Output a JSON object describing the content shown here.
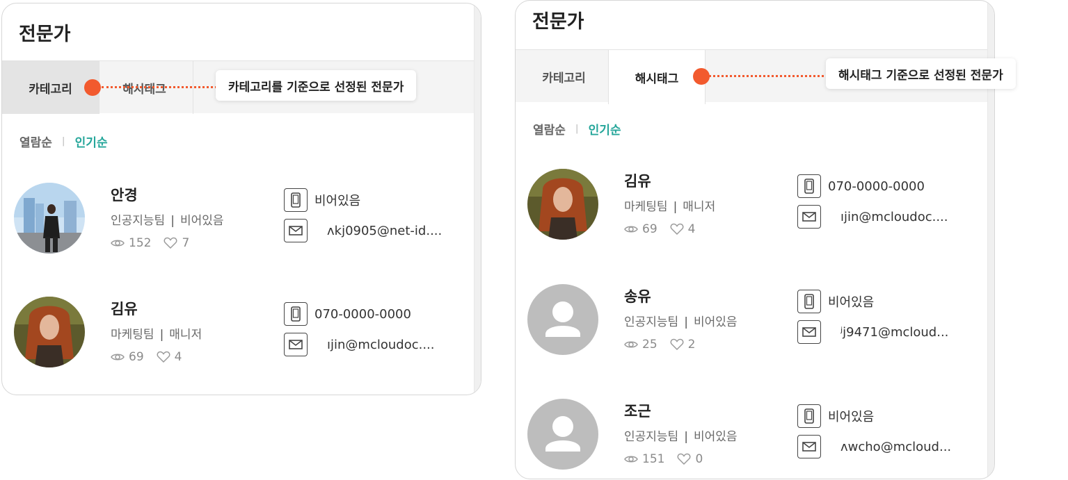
{
  "colors": {
    "accent": "#25a69a",
    "callout_dot": "#f25a2e"
  },
  "left": {
    "title": "전문가",
    "tabs": [
      "카테고리",
      "해시태그"
    ],
    "sort": [
      "열람순",
      "인기순"
    ],
    "callout": "카테고리를 기준으로 선정된 전문가",
    "experts": [
      {
        "name": "안경",
        "team": "인공지능팀",
        "role": "비어있음",
        "views": "152",
        "likes": "7",
        "phone": "비어있음",
        "email": "ʌkj0905@net-id....",
        "avatar": "photo-man"
      },
      {
        "name": "김유",
        "team": "마케팅팀",
        "role": "매니저",
        "views": "69",
        "likes": "4",
        "phone": "070-0000-0000",
        "email": "ıjin@mcloudoc....",
        "avatar": "photo-woman"
      }
    ]
  },
  "right": {
    "title": "전문가",
    "tabs": [
      "카테고리",
      "해시태그"
    ],
    "sort": [
      "열람순",
      "인기순"
    ],
    "callout": "해시태그 기준으로 선정된 전문가",
    "experts": [
      {
        "name": "김유",
        "team": "마케팅팀",
        "role": "매니저",
        "views": "69",
        "likes": "4",
        "phone": "070-0000-0000",
        "email": "ıjin@mcloudoc....",
        "avatar": "photo-woman"
      },
      {
        "name": "송유",
        "team": "인공지능팀",
        "role": "비어있음",
        "views": "25",
        "likes": "2",
        "phone": "비어있음",
        "email": "ʲj9471@mcloud...",
        "avatar": "placeholder"
      },
      {
        "name": "조근",
        "team": "인공지능팀",
        "role": "비어있음",
        "views": "151",
        "likes": "0",
        "phone": "비어있음",
        "email": "ʌwcho@mcloud...",
        "avatar": "placeholder"
      }
    ]
  }
}
